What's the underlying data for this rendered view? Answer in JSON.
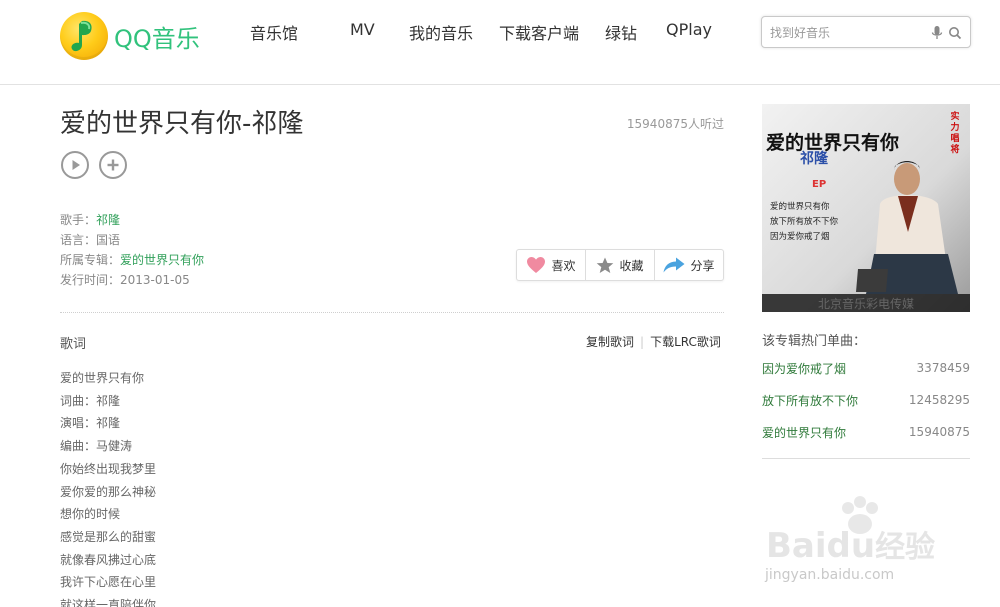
{
  "header": {
    "logo_text": "QQ音乐",
    "nav": [
      "音乐馆",
      "MV",
      "我的音乐",
      "下载客户端",
      "绿钻",
      "QPlay"
    ],
    "search_placeholder": "找到好音乐"
  },
  "song": {
    "title": "爱的世界只有你-祁隆",
    "listen_count": "15940875人听过",
    "singer_label": "歌手：",
    "singer": "祁隆",
    "language_label": "语言：",
    "language": "国语",
    "album_label": "所属专辑：",
    "album": "爱的世界只有你",
    "release_label": "发行时间：",
    "release_date": "2013-01-05"
  },
  "actions": {
    "like": "喜欢",
    "collect": "收藏",
    "share": "分享"
  },
  "lyrics": {
    "label": "歌词",
    "copy": "复制歌词",
    "download": "下载LRC歌词",
    "separator": "|",
    "lines": [
      "爱的世界只有你",
      "词曲：祁隆",
      "演唱：祁隆",
      "编曲：马健涛",
      "你始终出现我梦里",
      "爱你爱的那么神秘",
      "想你的时候",
      "感觉是那么的甜蜜",
      "就像春风拂过心底",
      "我许下心愿在心里",
      "就这样一直陪伴你"
    ]
  },
  "cover": {
    "title": "爱的世界只有你",
    "artist": "祁隆",
    "side_text": "实力唱将",
    "ep": "EP",
    "tracks": [
      "爱的世界只有你",
      "放下所有放不下你",
      "因为爱你戒了烟"
    ],
    "bottom_text": "北京音乐彩电传媒"
  },
  "hot": {
    "title": "该专辑热门单曲：",
    "items": [
      {
        "name": "因为爱你戒了烟",
        "count": "3378459"
      },
      {
        "name": "放下所有放不下你",
        "count": "12458295"
      },
      {
        "name": "爱的世界只有你",
        "count": "15940875"
      }
    ]
  },
  "watermark": {
    "brand": "Bai",
    "brand2": "du",
    "brand_cn": "经验",
    "url": "jingyan.baidu.com"
  },
  "colors": {
    "brand_green": "#31c27c",
    "link_green": "#31a05a",
    "like_pink": "#f08aa0",
    "share_blue": "#4aa3df"
  }
}
